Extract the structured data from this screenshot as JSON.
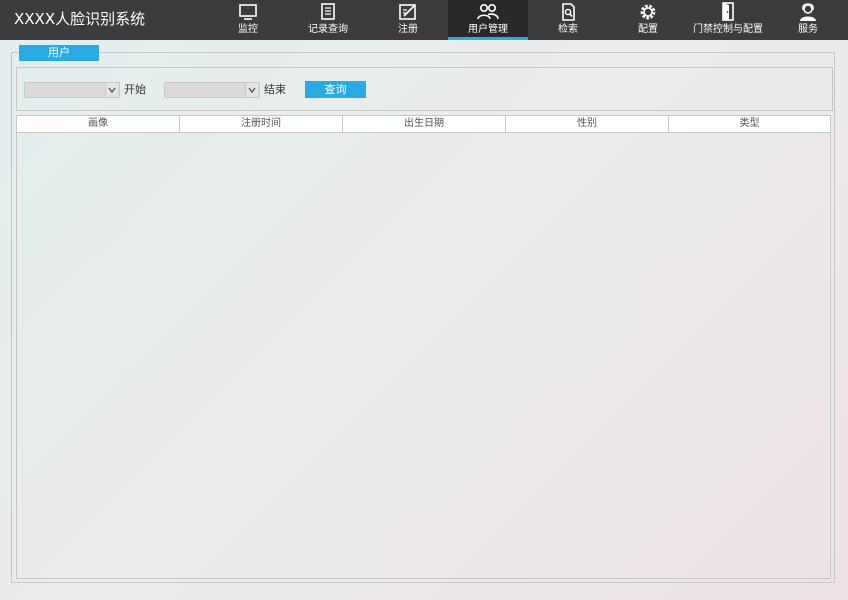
{
  "app": {
    "title": "XXXX人脸识别系统"
  },
  "nav": {
    "items": [
      {
        "label": "监控",
        "icon": "monitor-icon"
      },
      {
        "label": "记录查询",
        "icon": "document-list-icon"
      },
      {
        "label": "注册",
        "icon": "edit-form-icon"
      },
      {
        "label": "用户管理",
        "icon": "users-icon",
        "active": true
      },
      {
        "label": "检索",
        "icon": "search-document-icon"
      },
      {
        "label": "配置",
        "icon": "gear-icon"
      },
      {
        "label": "门禁控制与配置",
        "icon": "door-icon"
      },
      {
        "label": "服务",
        "icon": "support-agent-icon"
      }
    ]
  },
  "panel": {
    "legend": "用户",
    "filter": {
      "start_label": "开始",
      "end_label": "结束",
      "query_label": "查询",
      "start_value": "",
      "end_value": ""
    },
    "table": {
      "columns": [
        "画像",
        "注册时间",
        "出生日期",
        "性别",
        "类型"
      ],
      "rows": []
    }
  },
  "colors": {
    "topbar": "#3c3c3e",
    "accent": "#29abe2",
    "active_tab": "#28282a"
  }
}
